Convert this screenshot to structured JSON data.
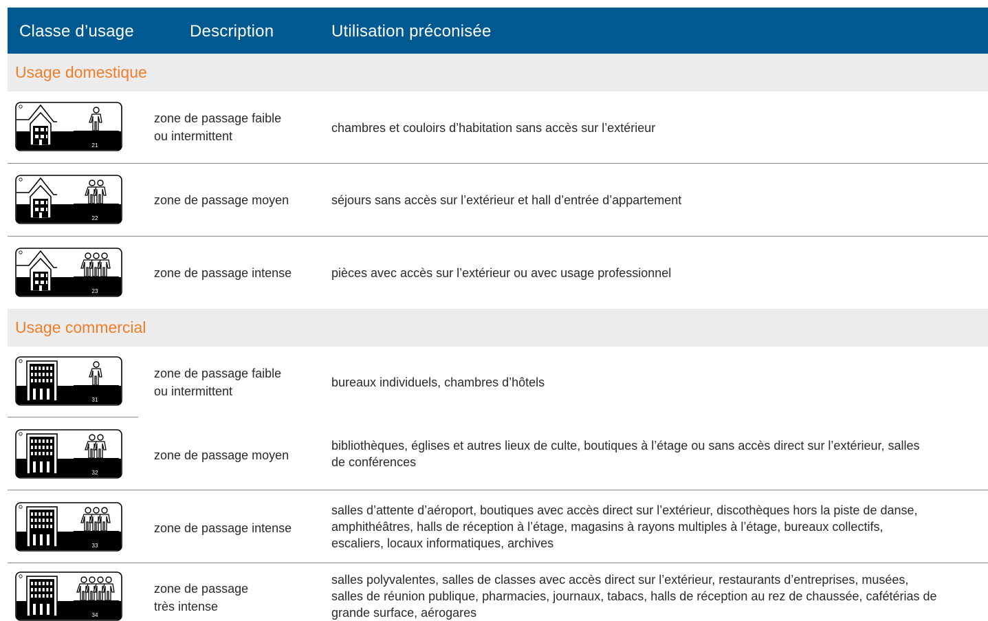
{
  "header": {
    "col_class": "Classe d’usage",
    "col_desc": "Description",
    "col_use": "Utilisation préconisée"
  },
  "colors": {
    "header_bg": "#005a91",
    "section_text": "#f07d2a",
    "section_bg": "#ececec"
  },
  "sections": [
    {
      "title": "Usage domestique",
      "rows": [
        {
          "icon": "domestic-21-icon",
          "class_number": "21",
          "people": 1,
          "desc_line1": "zone de passage faible",
          "desc_line2": "ou intermittent",
          "use_lines": [
            "chambres et couloirs d’habitation sans accès sur l’extérieur"
          ]
        },
        {
          "icon": "domestic-22-icon",
          "class_number": "22",
          "people": 2,
          "desc_line1": "zone de passage moyen",
          "desc_line2": "",
          "use_lines": [
            "séjours sans accès sur l’extérieur et hall d’entrée d’appartement"
          ]
        },
        {
          "icon": "domestic-23-icon",
          "class_number": "23",
          "people": 3,
          "desc_line1": "zone de passage intense",
          "desc_line2": "",
          "use_lines": [
            "pièces avec accès sur l’extérieur ou avec usage professionnel"
          ]
        }
      ]
    },
    {
      "title": "Usage commercial",
      "rows": [
        {
          "icon": "commercial-31-icon",
          "class_number": "31",
          "people": 1,
          "desc_line1": "zone de passage faible",
          "desc_line2": "ou intermittent",
          "use_lines": [
            "bureaux individuels, chambres d’hôtels"
          ]
        },
        {
          "icon": "commercial-32-icon",
          "class_number": "32",
          "people": 2,
          "desc_line1": "zone de passage moyen",
          "desc_line2": "",
          "use_lines": [
            "bibliothèques, églises et autres lieux de culte, boutiques à l’étage  ou sans accès direct sur l’extérieur, salles",
            "de conférences"
          ]
        },
        {
          "icon": "commercial-33-icon",
          "class_number": "33",
          "people": 3,
          "desc_line1": "zone de passage intense",
          "desc_line2": "",
          "use_lines": [
            "salles d’attente d’aéroport, boutiques avec accès direct sur l’extérieur, discothèques hors la piste de danse,",
            "amphithéâtres, halls de réception à l’étage, magasins à rayons multiples à l’étage, bureaux collectifs,",
            "escaliers, locaux informatiques, archives"
          ]
        },
        {
          "icon": "commercial-34-icon",
          "class_number": "34",
          "people": 4,
          "desc_line1": "zone de passage",
          "desc_line2": "très intense",
          "use_lines": [
            "salles polyvalentes, salles de classes avec accès direct sur l’extérieur, restaurants d’entreprises, musées,",
            "salles de réunion publique, pharmacies, journaux, tabacs, halls de réception au rez de chaussée, cafétérias de",
            "grande surface, aérogares"
          ]
        }
      ]
    }
  ]
}
